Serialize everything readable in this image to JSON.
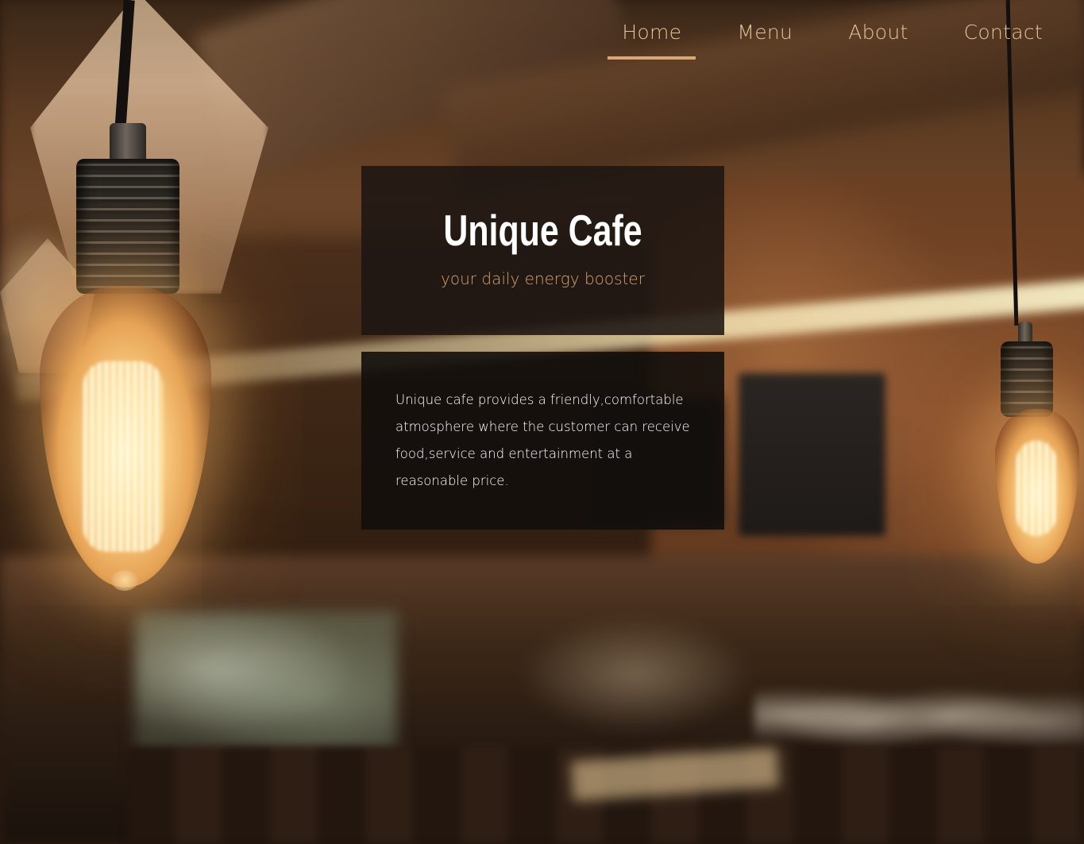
{
  "nav": {
    "items": [
      {
        "label": "Home",
        "active": true
      },
      {
        "label": "Menu",
        "active": false
      },
      {
        "label": "About",
        "active": false
      },
      {
        "label": "Contact",
        "active": false
      }
    ]
  },
  "hero": {
    "title": "Unique Cafe",
    "subtitle": "your daily energy booster"
  },
  "info": {
    "text": "Unique cafe provides a friendly,comfortable atmosphere where the customer can receive food,service and entertainment at a reasonable price."
  },
  "colors": {
    "accent": "#d9a876",
    "nav_text": "#e6c29a",
    "subtitle": "#d8a06a",
    "box_bg": "#1c1612"
  }
}
